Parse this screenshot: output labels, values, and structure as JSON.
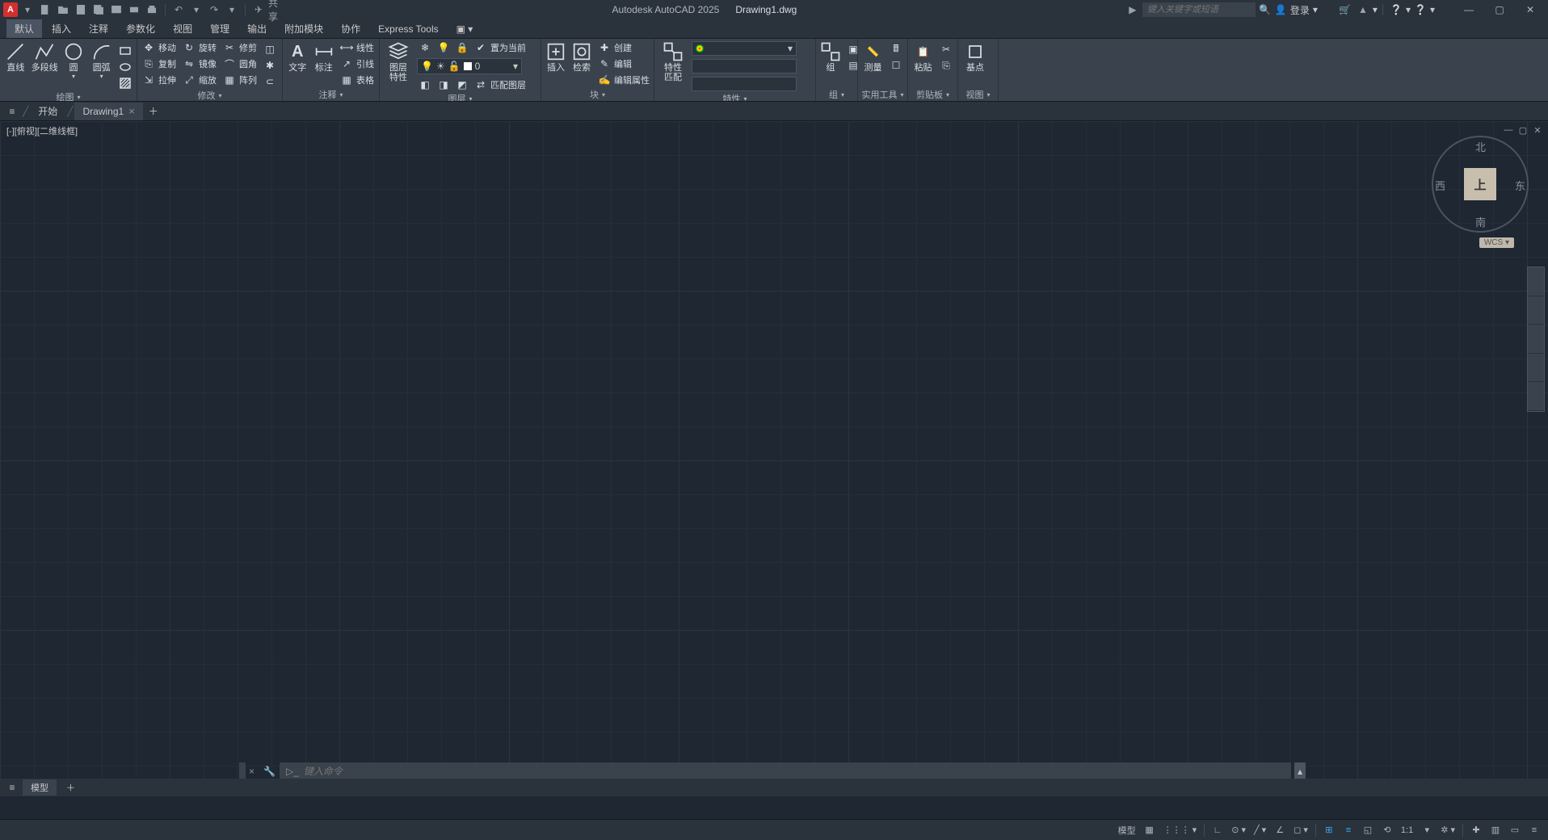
{
  "app": {
    "name": "Autodesk AutoCAD 2025",
    "file": "Drawing1.dwg",
    "search_placeholder": "键入关键字或短语",
    "login": "登录",
    "share": "共享"
  },
  "ribbon_tabs": [
    "默认",
    "插入",
    "注释",
    "参数化",
    "视图",
    "管理",
    "输出",
    "附加模块",
    "协作",
    "Express Tools"
  ],
  "active_tab": "默认",
  "panels": {
    "draw": {
      "title": "绘图",
      "tools_big": [
        {
          "id": "line",
          "label": "直线"
        },
        {
          "id": "pline",
          "label": "多段线"
        },
        {
          "id": "circle",
          "label": "圆"
        },
        {
          "id": "arc",
          "label": "圆弧"
        }
      ]
    },
    "modify": {
      "title": "修改",
      "rows": [
        [
          {
            "id": "move",
            "label": "移动"
          },
          {
            "id": "rotate",
            "label": "旋转"
          },
          {
            "id": "trim",
            "label": "修剪"
          }
        ],
        [
          {
            "id": "copy",
            "label": "复制"
          },
          {
            "id": "mirror",
            "label": "镜像"
          },
          {
            "id": "fillet",
            "label": "圆角"
          }
        ],
        [
          {
            "id": "stretch",
            "label": "拉伸"
          },
          {
            "id": "scale",
            "label": "缩放"
          },
          {
            "id": "array",
            "label": "阵列"
          }
        ]
      ]
    },
    "annot": {
      "title": "注释",
      "big": [
        {
          "id": "text",
          "label": "文字"
        },
        {
          "id": "dim",
          "label": "标注"
        }
      ],
      "rows": [
        {
          "id": "linear",
          "label": "线性"
        },
        {
          "id": "leader",
          "label": "引线"
        },
        {
          "id": "table",
          "label": "表格"
        }
      ]
    },
    "layer": {
      "title": "图层",
      "big": {
        "id": "layerprops",
        "label": "图层\n特性"
      },
      "rows": [
        {
          "id": "setcur",
          "label": "置为当前"
        },
        {
          "id": "match",
          "label": "匹配图层"
        }
      ]
    },
    "block": {
      "title": "块",
      "big": [
        {
          "id": "insert",
          "label": "插入"
        },
        {
          "id": "retrieve",
          "label": "检索"
        }
      ],
      "rows": [
        {
          "id": "create",
          "label": "创建"
        },
        {
          "id": "edit",
          "label": "编辑"
        },
        {
          "id": "editattr",
          "label": "编辑属性"
        }
      ]
    },
    "props": {
      "title": "特性",
      "big": {
        "id": "propmatch",
        "label": "特性\n匹配"
      }
    },
    "group": {
      "title": "组",
      "label": "组"
    },
    "util": {
      "title": "实用工具",
      "big": {
        "id": "measure",
        "label": "测量"
      }
    },
    "clip": {
      "title": "剪贴板",
      "big": {
        "id": "paste",
        "label": "粘贴"
      }
    },
    "view": {
      "title": "视图",
      "big": {
        "id": "base",
        "label": "基点"
      }
    }
  },
  "filetabs": {
    "start": "开始",
    "active": "Drawing1"
  },
  "viewport": {
    "label": "[-][俯视][二维线框]",
    "cube_face": "上",
    "north": "北",
    "south": "南",
    "east": "东",
    "west": "西",
    "wcs": "WCS"
  },
  "layouttabs": {
    "active": "模型"
  },
  "cmdline": {
    "placeholder": "键入命令"
  },
  "status": {
    "model": "模型",
    "scale": "1:1"
  }
}
